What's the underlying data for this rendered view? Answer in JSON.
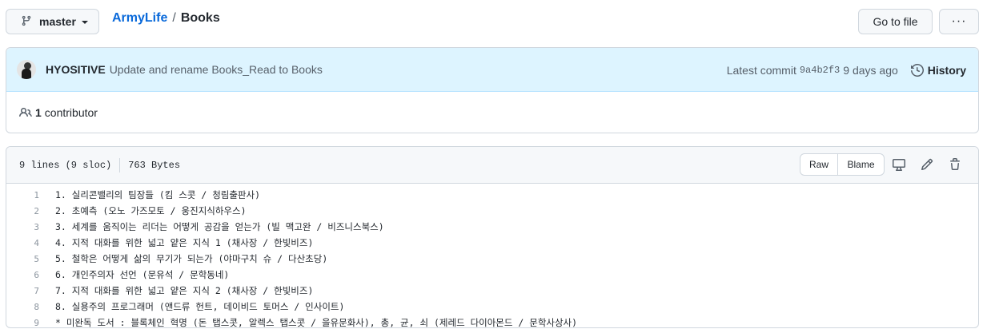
{
  "branch": {
    "name": "master",
    "icon": "git-branch-icon"
  },
  "breadcrumb": {
    "repo": "ArmyLife",
    "separator": "/",
    "file": "Books"
  },
  "actions": {
    "goto_file": "Go to file",
    "more": "···"
  },
  "commit": {
    "author": "HYOSITIVE",
    "message": "Update and rename Books_Read to Books",
    "latest_label": "Latest commit",
    "sha": "9a4b2f3",
    "time": "9 days ago",
    "history_label": "History"
  },
  "contributors": {
    "count": "1",
    "label": "contributor"
  },
  "file": {
    "lines_info": "9 lines (9 sloc)",
    "size": "763 Bytes",
    "raw_label": "Raw",
    "blame_label": "Blame"
  },
  "code_lines": [
    {
      "num": "1",
      "text": "1. 실리콘밸리의 팀장들 (킴 스콧 / 청림출판사)"
    },
    {
      "num": "2",
      "text": "2. 초예측 (오노 가즈모토 / 웅진지식하우스)"
    },
    {
      "num": "3",
      "text": "3. 세계를 움직이는 리더는 어떻게 공감을 얻는가 (빌 맥고완 / 비즈니스북스)"
    },
    {
      "num": "4",
      "text": "4. 지적 대화를 위한 넓고 얕은 지식 1 (채사장 / 한빛비즈)"
    },
    {
      "num": "5",
      "text": "5. 철학은 어떻게 삶의 무기가 되는가 (야마구치 슈 / 다산초당)"
    },
    {
      "num": "6",
      "text": "6. 개인주의자 선언 (문유석 / 문학동네)"
    },
    {
      "num": "7",
      "text": "7. 지적 대화를 위한 넓고 얕은 지식 2 (채사장 / 한빛비즈)"
    },
    {
      "num": "8",
      "text": "8. 실용주의 프로그래머 (앤드류 헌트, 데이비드 토머스 / 인사이트)"
    },
    {
      "num": "9",
      "text": "* 미완독 도서 : 블록체인 혁명 (돈 탭스콧, 알렉스 탭스콧 / 을유문화사), 총, 균, 쇠 (제레드 다이아몬드 / 문학사상사)"
    }
  ],
  "colors": {
    "link": "#0969da",
    "commit_bg": "#ddf4ff",
    "border": "#d0d7de"
  }
}
